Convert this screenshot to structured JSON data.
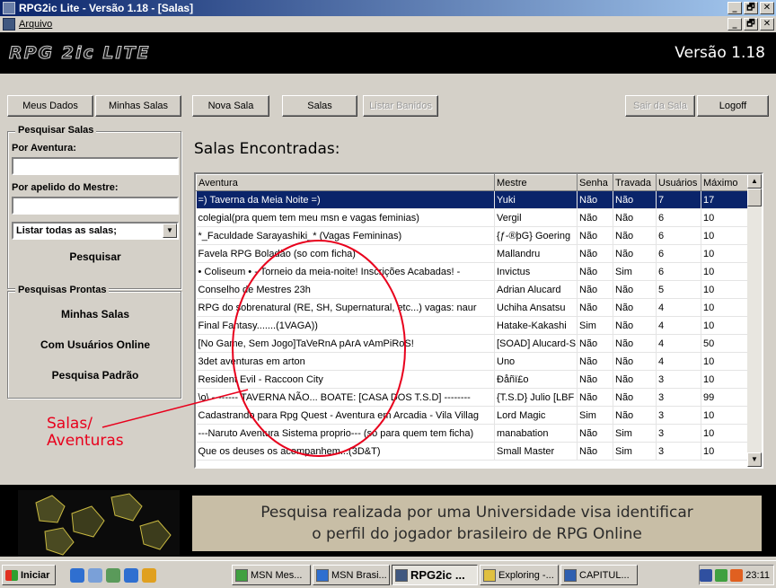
{
  "window": {
    "title": "RPG2ic Lite - Versão 1.18 - [Salas]",
    "controls": [
      "_",
      "🗗",
      "✕"
    ]
  },
  "menu": {
    "file": "Arquivo"
  },
  "header": {
    "logo": "RPG 2ic LITE",
    "version": "Versão 1.18"
  },
  "toolbar": {
    "meus_dados": "Meus Dados",
    "minhas_salas": "Minhas Salas",
    "nova_sala": "Nova Sala",
    "salas": "Salas",
    "listar_banidos": "Listar Banidos",
    "sair_da_sala": "Sair da Sala",
    "logoff": "Logoff"
  },
  "sidebar": {
    "search_group": "Pesquisar Salas",
    "by_adventure_label": "Por Aventura:",
    "by_adventure_value": "",
    "by_master_label": "Por apelido do Mestre:",
    "by_master_value": "",
    "list_select": "Listar todas as salas;",
    "search_button": "Pesquisar",
    "ready_group": "Pesquisas Prontas",
    "ready_items": [
      "Minhas Salas",
      "Com Usuários Online",
      "Pesquisa Padrão"
    ]
  },
  "main": {
    "title": "Salas Encontradas:"
  },
  "table": {
    "columns": [
      "Aventura",
      "Mestre",
      "Senha",
      "Travada",
      "Usuários",
      "Máximo"
    ],
    "rows": [
      [
        "=) Taverna da Meia Noite =)",
        "Yuki",
        "Não",
        "Não",
        "7",
        "17"
      ],
      [
        "colegial(pra quem tem meu msn e vagas feminias)",
        "Vergil",
        "Não",
        "Não",
        "6",
        "10"
      ],
      [
        "*_Faculdade Sarayashiki_* (Vagas Femininas)",
        "{ƒ-®þG} Goering",
        "Não",
        "Não",
        "6",
        "10"
      ],
      [
        "Favela RPG Boladão (so com ficha)",
        "Mallandru",
        "Não",
        "Não",
        "6",
        "10"
      ],
      [
        "• Coliseum •  - Torneio da meia-noite! Inscrições Acabadas! -",
        "Invictus",
        "Não",
        "Sim",
        "6",
        "10"
      ],
      [
        "Conselho de Mestres 23h",
        "Adrian Alucard",
        "Não",
        "Não",
        "5",
        "10"
      ],
      [
        "RPG do sobrenatural (RE, SH, Supernatural, etc...) vagas: naur",
        "Uchiha Ansatsu",
        "Não",
        "Não",
        "4",
        "10"
      ],
      [
        "Final Fantasy.......(1VAGA))",
        "Hatake-Kakashi",
        "Sim",
        "Não",
        "4",
        "10"
      ],
      [
        "[No Game, Sem Jogo]TaVeRnA pArA vAmPiRoS!",
        "[SOAD] Alucard-S",
        "Não",
        "Não",
        "4",
        "50"
      ],
      [
        "3det aventuras em arton",
        "Uno",
        "Não",
        "Não",
        "4",
        "10"
      ],
      [
        "Resident Evil - Raccoon City",
        "Ðåñï£o",
        "Não",
        "Não",
        "3",
        "10"
      ],
      [
        "\\o\\ -------- TAVERNA NÃO... BOATE: [CASA DOS T.S.D] --------",
        "{T.S.D} Julio [LBF",
        "Não",
        "Não",
        "3",
        "99"
      ],
      [
        "Cadastrando para Rpg Quest - Aventura em Arcadia - Vila Villag",
        "Lord Magic",
        "Sim",
        "Não",
        "3",
        "10"
      ],
      [
        "---Naruto Aventura Sistema proprio--- (so para quem tem ficha)",
        "manabation",
        "Não",
        "Sim",
        "3",
        "10"
      ],
      [
        "Que os deuses os acompanhem...(3D&T)",
        "Small Master",
        "Não",
        "Sim",
        "3",
        "10"
      ]
    ]
  },
  "annotation": {
    "line1": "Salas/",
    "line2": "Aventuras",
    "color": "#e8001c"
  },
  "banner": {
    "line1": "Pesquisa realizada por uma Universidade visa identificar",
    "line2": "o perfil do jogador brasileiro de RPG Online"
  },
  "taskbar": {
    "start": "Iniciar",
    "tasks": [
      "MSN Mes...",
      "MSN Brasi...",
      "RPG2ic ...",
      "Exploring -...",
      "CAPITUL..."
    ],
    "clock": "23:11"
  },
  "colors": {
    "selection": "#0a246a",
    "titlebar": "#0a246a",
    "face": "#d4d0c8"
  }
}
